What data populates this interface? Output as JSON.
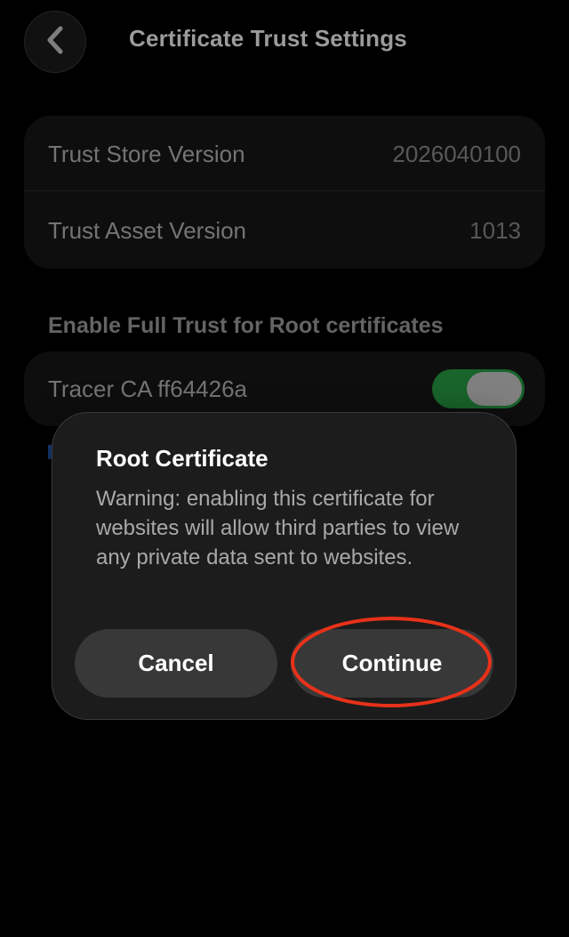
{
  "header": {
    "title": "Certificate Trust Settings",
    "back_icon": "chevron-left-icon"
  },
  "versions": {
    "rows": [
      {
        "label": "Trust Store Version",
        "value": "2026040100"
      },
      {
        "label": "Trust Asset Version",
        "value": "1013"
      }
    ]
  },
  "root_section": {
    "title": "Enable Full Trust for Root certificates",
    "certificates": [
      {
        "name": "Tracer CA ff64426a",
        "enabled": true
      }
    ]
  },
  "alert": {
    "title": "Root Certificate",
    "message": "Warning: enabling this certificate for websites will allow third parties to view any private data sent to websites.",
    "cancel_label": "Cancel",
    "continue_label": "Continue"
  },
  "colors": {
    "background": "#000000",
    "card": "#121212",
    "toggle_on": "#1e7a35",
    "highlight": "#e8311a"
  }
}
